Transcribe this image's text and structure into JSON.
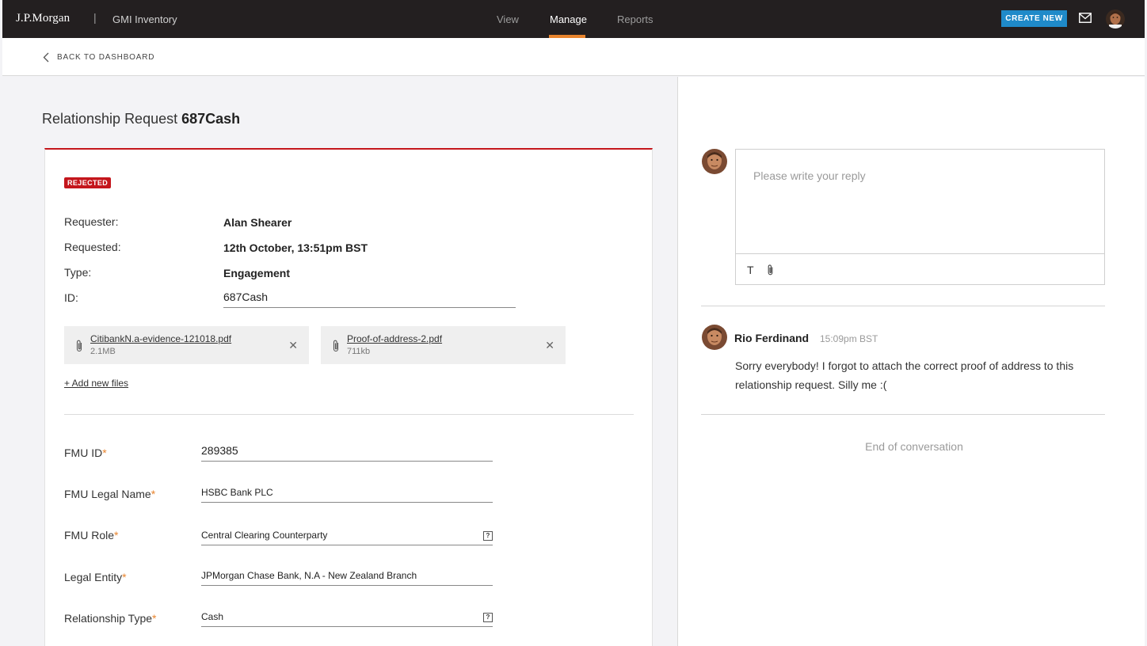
{
  "header": {
    "logo": "J.P.Morgan",
    "separator": "|",
    "app_name": "GMI Inventory",
    "nav": [
      "View",
      "Manage",
      "Reports"
    ],
    "active_nav": "Manage",
    "create_button": "CREATE NEW",
    "accent_color": "#e8842e"
  },
  "breadcrumb": {
    "back_label": "BACK TO DASHBOARD"
  },
  "request": {
    "title_prefix": "Relationship Request",
    "title_id": "687Cash",
    "status": "REJECTED",
    "status_color": "#c4161c",
    "info": [
      {
        "label": "Requester:",
        "value": "Alan Shearer"
      },
      {
        "label": "Requested:",
        "value": "12th October, 13:51pm BST"
      },
      {
        "label": "Type:",
        "value": "Engagement"
      }
    ],
    "id_label": "ID:",
    "id_value": "687Cash",
    "files": [
      {
        "name": "CitibankN.a-evidence-121018.pdf",
        "size": "2.1MB"
      },
      {
        "name": "Proof-of-address-2.pdf",
        "size": "711kb"
      }
    ],
    "add_files": "+ Add new files"
  },
  "form": {
    "required_mark": "*",
    "fields": [
      {
        "label": "FMU ID",
        "value": "289385"
      },
      {
        "label": "FMU Legal Name",
        "value": "HSBC Bank PLC"
      },
      {
        "label": "FMU Role",
        "value": "Central Clearing Counterparty"
      },
      {
        "label": "Legal Entity",
        "value": "JPMorgan Chase Bank, N.A - New Zealand Branch"
      },
      {
        "label": "Relationship Type",
        "value": "Cash"
      }
    ],
    "help_glyph": "?"
  },
  "conversation": {
    "reply_placeholder": "Please write your reply",
    "text_tool": "T",
    "messages": [
      {
        "author": "Rio Ferdinand",
        "time": "15:09pm BST",
        "text": "Sorry everybody! I forgot to attach the correct proof of address to this relationship request. Silly me :("
      }
    ],
    "end_label": "End of conversation"
  }
}
